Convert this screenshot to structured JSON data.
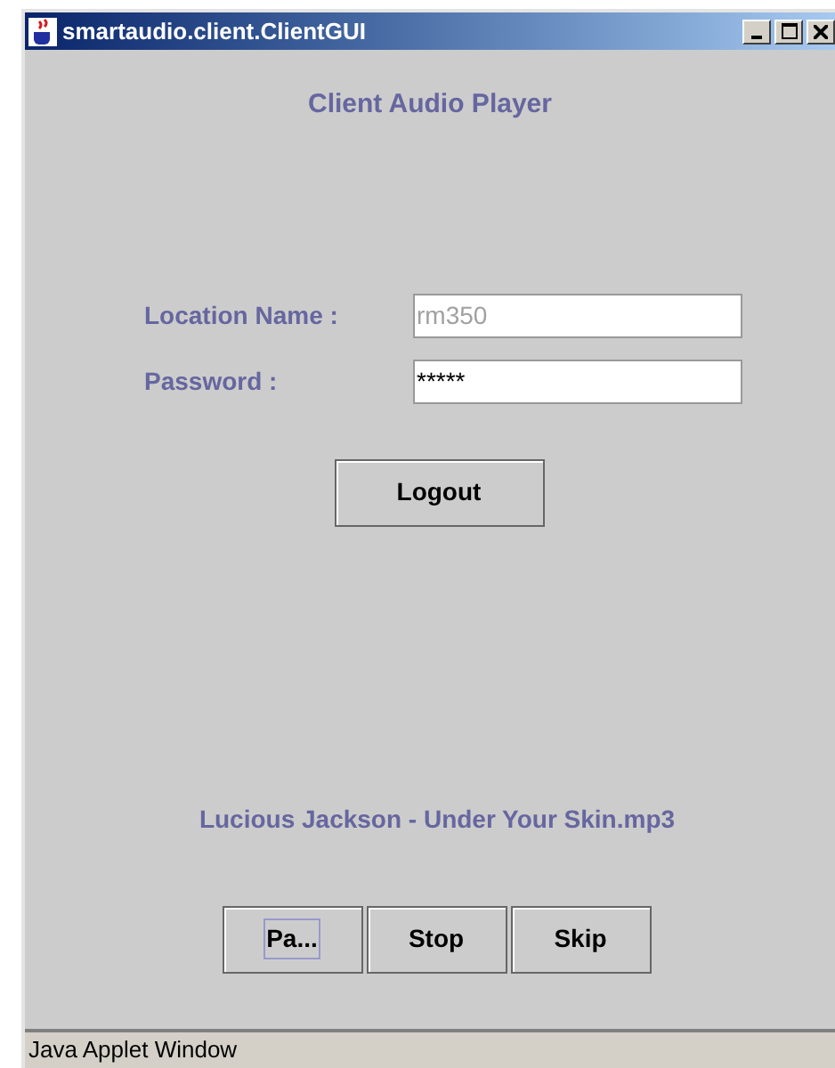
{
  "window": {
    "title": "smartaudio.client.ClientGUI"
  },
  "heading": "Client Audio Player",
  "fields": [
    {
      "label": "Location Name :",
      "value": "rm350",
      "disabled": true
    },
    {
      "label": "Password :",
      "value": "*****",
      "disabled": false
    }
  ],
  "logout_button": "Logout",
  "now_playing": "Lucious Jackson - Under Your Skin.mp3",
  "controls": [
    {
      "label": "Pa...",
      "focused": true
    },
    {
      "label": "Stop",
      "focused": false
    },
    {
      "label": "Skip",
      "focused": false
    }
  ],
  "status_bar": "Java Applet Window"
}
